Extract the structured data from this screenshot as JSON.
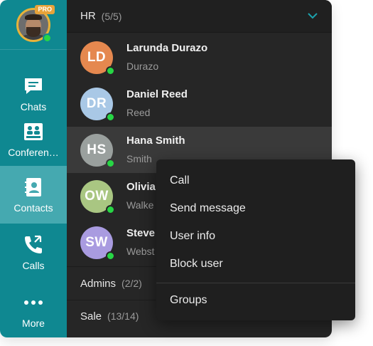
{
  "profile": {
    "badge": "PRO"
  },
  "nav": [
    {
      "label": "Chats",
      "icon": "chat-icon"
    },
    {
      "label": "Conferen…",
      "icon": "conference-icon"
    },
    {
      "label": "Contacts",
      "icon": "contacts-icon",
      "active": true
    },
    {
      "label": "Calls",
      "icon": "phone-icon"
    },
    {
      "label": "More",
      "icon": "more-icon"
    }
  ],
  "groups": {
    "hr": {
      "name": "HR",
      "count": "(5/5)"
    },
    "admins": {
      "name": "Admins",
      "count": "(2/2)"
    },
    "sale": {
      "name": "Sale",
      "count": "(13/14)"
    }
  },
  "contacts": [
    {
      "initials": "LD",
      "name": "Larunda Durazo",
      "sub": "Durazo",
      "color": "#e5884f"
    },
    {
      "initials": "DR",
      "name": "Daniel Reed",
      "sub": "Reed",
      "color": "#a9c8e6"
    },
    {
      "initials": "HS",
      "name": "Hana Smith",
      "sub": "Smith",
      "color": "#9aa09e"
    },
    {
      "initials": "OW",
      "name": "Olivia",
      "sub": "Walke",
      "color": "#a9c682"
    },
    {
      "initials": "SW",
      "name": "Steve",
      "sub": "Webst",
      "color": "#a99be0"
    }
  ],
  "context_menu": {
    "items": [
      "Call",
      "Send message",
      "User info",
      "Block user"
    ],
    "footer": "Groups"
  },
  "colors": {
    "rail": "#0f8891",
    "rail_active": "#45a9b0",
    "online": "#27d645",
    "chevron": "#1ba2ad"
  }
}
